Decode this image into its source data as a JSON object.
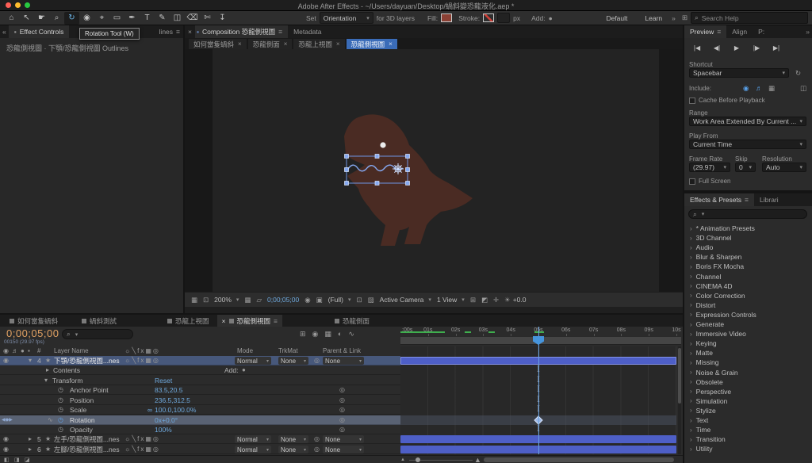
{
  "titlebar": {
    "title": "Adobe After Effects - ~/Users/dayuan/Desktop/蝸斜變恐龍液化.aep *"
  },
  "toolbar": {
    "tools": [
      {
        "name": "home-tool",
        "glyph": "⌂",
        "active": false
      },
      {
        "name": "selection-tool",
        "glyph": "↖",
        "active": false
      },
      {
        "name": "hand-tool",
        "glyph": "☛",
        "active": false
      },
      {
        "name": "zoom-tool",
        "glyph": "⌕",
        "active": false
      },
      {
        "name": "rotation-tool",
        "glyph": "↻",
        "active": true
      },
      {
        "name": "camera-tool",
        "glyph": "◉",
        "active": false
      },
      {
        "name": "pan-behind-tool",
        "glyph": "⌖",
        "active": false
      },
      {
        "name": "shape-tool",
        "glyph": "▭",
        "active": false
      },
      {
        "name": "pen-tool",
        "glyph": "✒",
        "active": false
      },
      {
        "name": "type-tool",
        "glyph": "T",
        "active": false
      },
      {
        "name": "brush-tool",
        "glyph": "✎",
        "active": false
      },
      {
        "name": "clone-stamp-tool",
        "glyph": "◫",
        "active": false
      },
      {
        "name": "eraser-tool",
        "glyph": "⌫",
        "active": false
      },
      {
        "name": "roto-brush-tool",
        "glyph": "✄",
        "active": false
      },
      {
        "name": "puppet-pin-tool",
        "glyph": "↧",
        "active": false
      }
    ],
    "set_label": "Set",
    "orientation_value": "Orientation",
    "for_3d_label": "for 3D layers",
    "fill_label": "Fill:",
    "stroke_label": "Stroke:",
    "px_label": "px",
    "add_label": "Add:",
    "workspace_default": "Default",
    "workspace_learn": "Learn",
    "overflow": "»",
    "search_placeholder": "Search Help"
  },
  "left_panel": {
    "collapse": "«",
    "tab_label": "Effect Controls",
    "tab_overflow": "lines",
    "tooltip": "Rotation Tool (W)",
    "breadcrumb": "恐龍側視圖 · 下顎/恐龍側視圖 Outlines"
  },
  "composition_panel": {
    "tab_composition": "Composition 恐龍側視圖",
    "tab_metadata": "Metadata",
    "view_tabs": [
      {
        "label": "如何當隻蝸斜",
        "active": false
      },
      {
        "label": "恐龍側面",
        "active": false
      },
      {
        "label": "恐龍上視圖",
        "active": false
      },
      {
        "label": "恐龍側視圖",
        "active": true
      }
    ],
    "footer": {
      "zoom": "200%",
      "time": "0;00;05;00",
      "resolution": "(Full)",
      "camera": "Active Camera",
      "view_layout": "1 View",
      "exposure": "+0.0"
    }
  },
  "preview_panel": {
    "tab_preview": "Preview",
    "tab_align": "Align",
    "tab_more": "P:",
    "overflow": "»",
    "transport": [
      {
        "name": "first-frame-button",
        "glyph": "|◀"
      },
      {
        "name": "previous-frame-button",
        "glyph": "◀|"
      },
      {
        "name": "play-button",
        "glyph": "▶"
      },
      {
        "name": "next-frame-button",
        "glyph": "|▶"
      },
      {
        "name": "last-frame-button",
        "glyph": "▶|"
      }
    ],
    "shortcut_label": "Shortcut",
    "shortcut_value": "Spacebar",
    "include_label": "Include:",
    "cache_label": "Cache Before Playback",
    "range_label": "Range",
    "range_value": "Work Area Extended By Current ...",
    "play_from_label": "Play From",
    "play_from_value": "Current Time",
    "frame_rate_label": "Frame Rate",
    "skip_label": "Skip",
    "resolution_label": "Resolution",
    "frame_rate_value": "(29.97)",
    "skip_value": "0",
    "resolution_value": "Auto",
    "full_screen_label": "Full Screen"
  },
  "effects_panel": {
    "tab_effects": "Effects & Presets",
    "tab_libraries": "Librari",
    "items": [
      "* Animation Presets",
      "3D Channel",
      "Audio",
      "Blur & Sharpen",
      "Boris FX Mocha",
      "Channel",
      "CINEMA 4D",
      "Color Correction",
      "Distort",
      "Expression Controls",
      "Generate",
      "Immersive Video",
      "Keying",
      "Matte",
      "Missing",
      "Noise & Grain",
      "Obsolete",
      "Perspective",
      "Simulation",
      "Stylize",
      "Text",
      "Time",
      "Transition",
      "Utility"
    ]
  },
  "timeline": {
    "tabs": [
      {
        "label": "如何當隻蝸斜",
        "active": false
      },
      {
        "label": "蝸斜測試",
        "active": false
      },
      {
        "label": "恐龍上視圖",
        "active": false
      },
      {
        "label": "恐龍側視圖",
        "active": true
      },
      {
        "label": "恐龍側面",
        "active": false
      }
    ],
    "current_time": "0;00;05;00",
    "frame_info": "00150 (29.97 fps)",
    "header": {
      "number": "#",
      "layer_name": "Layer Name",
      "mode": "Mode",
      "trkmat": "TrkMat",
      "parent": "Parent & Link"
    },
    "ruler_ticks": [
      ":00s",
      "01s",
      "02s",
      "03s",
      "04s",
      "05s",
      "06s",
      "07s",
      "08s",
      "09s",
      "10s"
    ],
    "layers": [
      {
        "index": "4",
        "name": "下顎/恐龍側視圖...nes",
        "mode": "Normal",
        "trkmat": "None",
        "parent": "None"
      },
      {
        "index": "5",
        "name": "左手/恐龍側視圖...nes",
        "mode": "Normal",
        "trkmat": "None",
        "parent": "None"
      },
      {
        "index": "6",
        "name": "左腳/恐龍側視圖...nes",
        "mode": "Normal",
        "trkmat": "None",
        "parent": "None"
      }
    ],
    "properties": {
      "contents_label": "Contents",
      "add_label": "Add:",
      "transform_label": "Transform",
      "reset_label": "Reset",
      "anchor_label": "Anchor Point",
      "anchor_value": "83.5,20.5",
      "position_label": "Position",
      "position_value": "236.5,312.5",
      "scale_label": "Scale",
      "scale_value": "100.0,100.0%",
      "rotation_label": "Rotation",
      "rotation_value": "0x+0.0°",
      "opacity_label": "Opacity",
      "opacity_value": "100%"
    }
  },
  "colors": {
    "accent_blue": "#3a6cb8",
    "value_blue": "#6ea8dc",
    "time_orange": "#e2a263",
    "layer_bar_blue": "#4e5fc7",
    "selected_row": "#47587b",
    "dinosaur_brown": "#4a2b23"
  }
}
